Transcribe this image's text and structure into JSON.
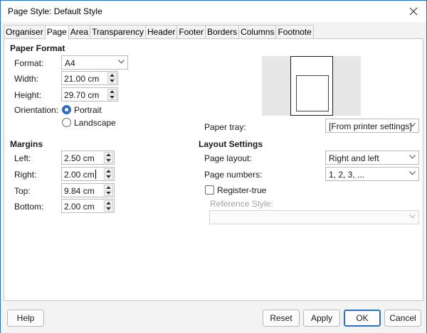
{
  "window": {
    "title": "Page Style: Default Style"
  },
  "tabs": [
    "Organiser",
    "Page",
    "Area",
    "Transparency",
    "Header",
    "Footer",
    "Borders",
    "Columns",
    "Footnote"
  ],
  "active_tab": "Page",
  "paper_format": {
    "heading": "Paper Format",
    "format_label": "Format:",
    "format_value": "A4",
    "width_label": "Width:",
    "width_value": "21.00 cm",
    "height_label": "Height:",
    "height_value": "29.70 cm",
    "orientation_label": "Orientation:",
    "portrait_label": "Portrait",
    "landscape_label": "Landscape",
    "orientation_selected": "Portrait",
    "paper_tray_label": "Paper tray:",
    "paper_tray_value": "[From printer settings]"
  },
  "margins": {
    "heading": "Margins",
    "left_label": "Left:",
    "left_value": "2.50 cm",
    "right_label": "Right:",
    "right_value": "2.00 cm",
    "top_label": "Top:",
    "top_value": "9.84 cm",
    "bottom_label": "Bottom:",
    "bottom_value": "2.00 cm"
  },
  "layout_settings": {
    "heading": "Layout Settings",
    "page_layout_label": "Page layout:",
    "page_layout_value": "Right and left",
    "page_numbers_label": "Page numbers:",
    "page_numbers_value": "1, 2, 3, ...",
    "register_true_label": "Register-true",
    "register_true_checked": false,
    "reference_style_label": "Reference Style:",
    "reference_style_value": ""
  },
  "buttons": {
    "help": "Help",
    "reset": "Reset",
    "apply": "Apply",
    "ok": "OK",
    "cancel": "Cancel"
  },
  "icons": {
    "close": "close-icon",
    "spin_up": "chevron-up-icon",
    "spin_down": "chevron-down-icon",
    "dropdown": "chevron-down-icon"
  },
  "colors": {
    "accent": "#2b6cc4",
    "preview_bg": "#e6e6e6"
  }
}
